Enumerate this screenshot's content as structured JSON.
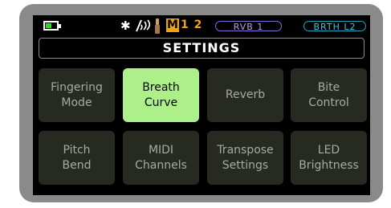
{
  "status": {
    "battery_level": 0.5,
    "icons": [
      "bluetooth-icon",
      "breath-wave-icon",
      "reed-icon"
    ],
    "bluetooth_glyph": "✱",
    "mode_letter": "M",
    "mode_numbers": "1 2",
    "rvb_label": "RVB 1",
    "brth_label": "BRTH L2"
  },
  "title": "SETTINGS",
  "menu": {
    "selected_index": 1,
    "items": [
      {
        "label": "Fingering\nMode"
      },
      {
        "label": "Breath\nCurve"
      },
      {
        "label": "Reverb"
      },
      {
        "label": "Bite\nControl"
      },
      {
        "label": "Pitch\nBend"
      },
      {
        "label": "MIDI\nChannels"
      },
      {
        "label": "Transpose\nSettings"
      },
      {
        "label": "LED\nBrightness"
      }
    ]
  },
  "colors": {
    "selected_tile": "#adf08a",
    "tile": "#262a20",
    "mode_accent": "#f2a20c",
    "rvb_accent": "#8c6ad6",
    "brth_accent": "#1fa3b8",
    "battery": "#2fdc1f"
  }
}
